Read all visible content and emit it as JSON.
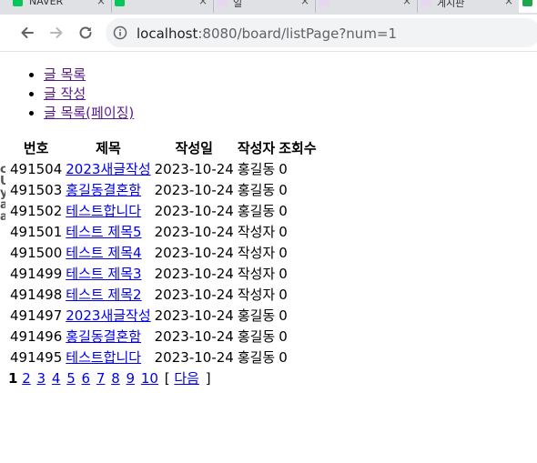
{
  "browser": {
    "tabs": [
      {
        "title": "NAVER",
        "favicon_color": "#03c75a",
        "active": false
      },
      {
        "title": "",
        "favicon_color": "#03c75a",
        "active": false
      },
      {
        "title": "일",
        "favicon_color": "#e8d5f0",
        "active": false
      },
      {
        "title": "",
        "favicon_color": "#e8d5f0",
        "active": false
      },
      {
        "title": "게시판",
        "favicon_color": "#e8d5f0",
        "active": false
      },
      {
        "title": "",
        "favicon_color": "#1ba94c",
        "active": true
      }
    ],
    "url_host": "localhost",
    "url_rest": ":8080/board/listPage?num=1"
  },
  "menu": {
    "items": [
      {
        "label": "글 목록",
        "visited": true
      },
      {
        "label": "글 작성",
        "visited": true
      },
      {
        "label": "글 목록(페이징)",
        "visited": true
      }
    ]
  },
  "table": {
    "headers": [
      "번호",
      "제목",
      "작성일",
      "작성자",
      "조회수"
    ],
    "rows": [
      {
        "no": "491504",
        "title": "2023새글작성",
        "date": "2023-10-24",
        "writer": "홍길동",
        "views": "0"
      },
      {
        "no": "491503",
        "title": "홍길동결혼함",
        "date": "2023-10-24",
        "writer": "홍길동",
        "views": "0"
      },
      {
        "no": "491502",
        "title": "테스트합니다",
        "date": "2023-10-24",
        "writer": "홍길동",
        "views": "0"
      },
      {
        "no": "491501",
        "title": "테스트 제목5",
        "date": "2023-10-24",
        "writer": "작성자",
        "views": "0"
      },
      {
        "no": "491500",
        "title": "테스트 제목4",
        "date": "2023-10-24",
        "writer": "작성자",
        "views": "0"
      },
      {
        "no": "491499",
        "title": "테스트 제목3",
        "date": "2023-10-24",
        "writer": "작성자",
        "views": "0"
      },
      {
        "no": "491498",
        "title": "테스트 제목2",
        "date": "2023-10-24",
        "writer": "작성자",
        "views": "0"
      },
      {
        "no": "491497",
        "title": "2023새글작성",
        "date": "2023-10-24",
        "writer": "홍길동",
        "views": "0"
      },
      {
        "no": "491496",
        "title": "홍길동결혼함",
        "date": "2023-10-24",
        "writer": "홍길동",
        "views": "0"
      },
      {
        "no": "491495",
        "title": "테스트합니다",
        "date": "2023-10-24",
        "writer": "홍길동",
        "views": "0"
      }
    ]
  },
  "pager": {
    "current": "1",
    "pages": [
      "2",
      "3",
      "4",
      "5",
      "6",
      "7",
      "8",
      "9",
      "10"
    ],
    "open_bracket": "[",
    "next_label": "다음",
    "close_bracket": "]"
  },
  "left_clipped_text": [
    "ci",
    "U",
    "y",
    "a",
    "a"
  ]
}
